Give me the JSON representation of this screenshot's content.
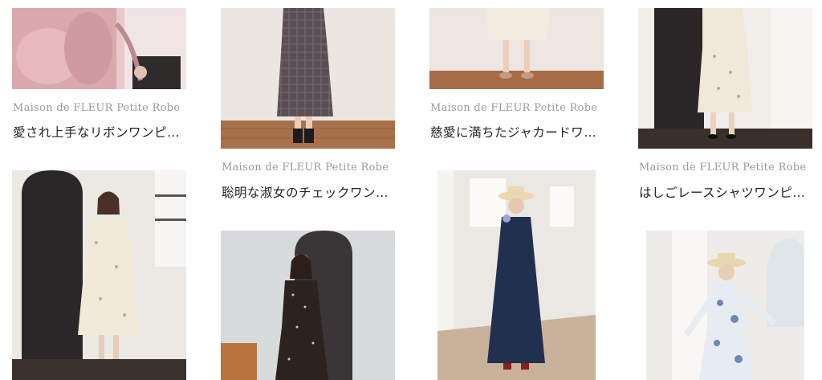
{
  "products": [
    {
      "brand": "Maison de FLEUR Petite Robe",
      "name": "愛され上手なリボンワンピ…",
      "image": "pink-ribbon-dress-photo"
    },
    {
      "brand": "Maison de FLEUR Petite Robe",
      "name": "聡明な淑女のチェックワン…",
      "image": "brown-check-dress-photo"
    },
    {
      "brand": "Maison de FLEUR Petite Robe",
      "name": "慈愛に満ちたジャカードワ…",
      "image": "ivory-jacquard-dress-photo"
    },
    {
      "brand": "Maison de FLEUR Petite Robe",
      "name": "はしごレースシャツワンピ…",
      "image": "floral-shirt-dress-photo"
    }
  ],
  "row2": [
    {
      "image": "floral-puff-sleeve-dress-photo"
    },
    {
      "image": "black-dot-dress-photo"
    },
    {
      "image": "navy-dress-straw-hat-photo"
    },
    {
      "image": "blue-floral-dress-hat-photo"
    }
  ]
}
